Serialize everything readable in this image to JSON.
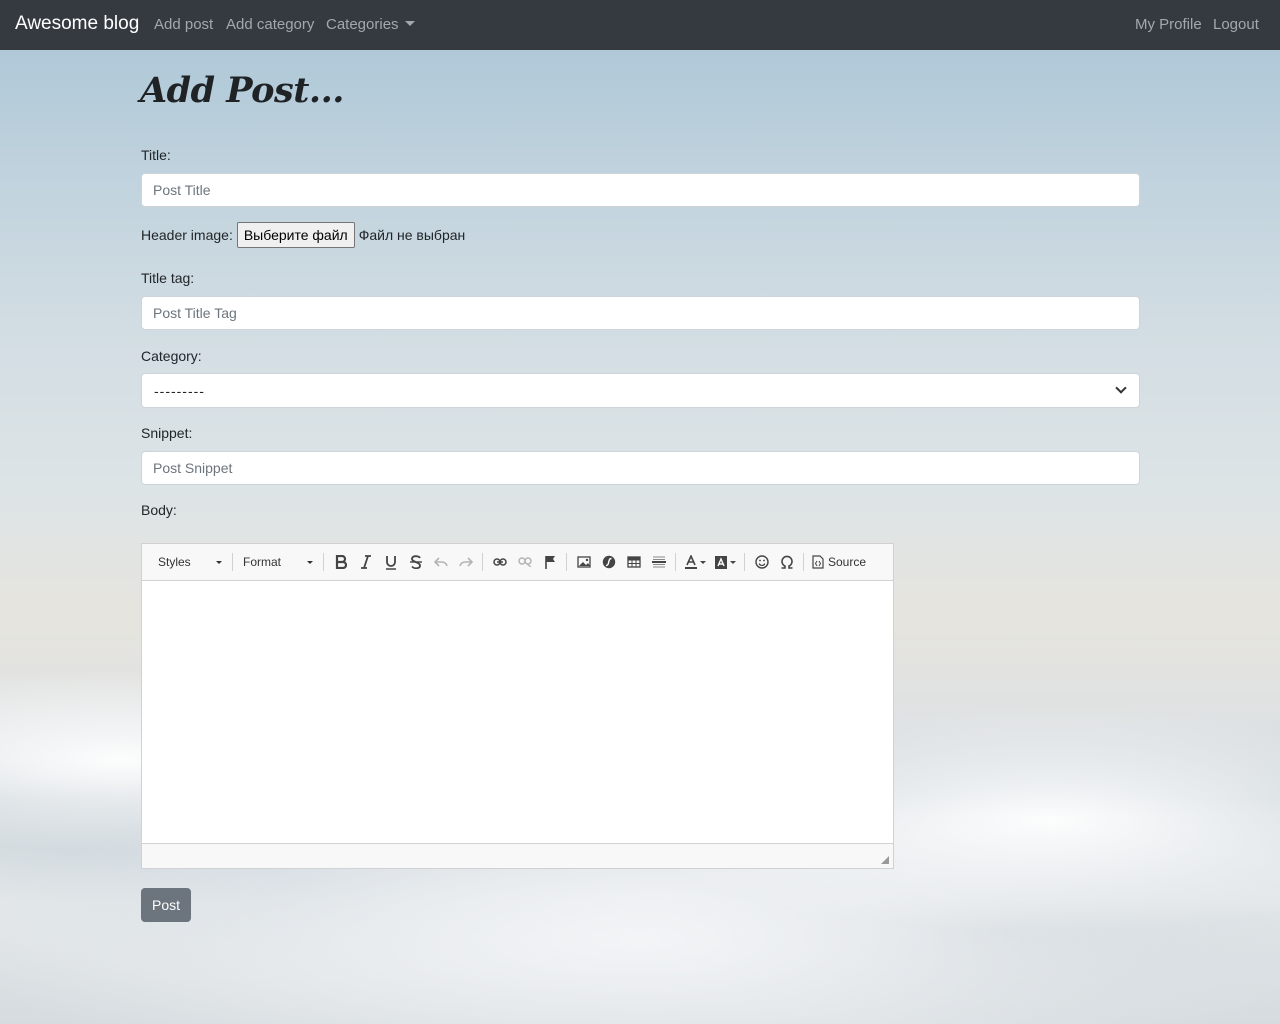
{
  "navbar": {
    "brand": "Awesome blog",
    "links": [
      "Add post",
      "Add category",
      "Categories"
    ],
    "right_links": [
      "My Profile",
      "Logout"
    ]
  },
  "page": {
    "title": "Add Post..."
  },
  "form": {
    "title_label": "Title:",
    "title_placeholder": "Post Title",
    "header_image_label": "Header image:",
    "file_button": "Выберите файл",
    "file_status": "Файл не выбран",
    "title_tag_label": "Title tag:",
    "title_tag_placeholder": "Post Title Tag",
    "category_label": "Category:",
    "category_selected": "---------",
    "snippet_label": "Snippet:",
    "snippet_placeholder": "Post Snippet",
    "body_label": "Body:",
    "submit_label": "Post"
  },
  "editor": {
    "styles_combo": "Styles",
    "format_combo": "Format",
    "source_label": "Source",
    "buttons": [
      "bold-icon",
      "italic-icon",
      "underline-icon",
      "strikethrough-icon",
      "undo-icon",
      "redo-icon",
      "link-icon",
      "unlink-icon",
      "anchor-flag-icon",
      "image-icon",
      "flash-icon",
      "table-icon",
      "horizontal-rule-icon",
      "text-color-icon",
      "background-color-icon",
      "smiley-icon",
      "special-char-icon",
      "source-icon"
    ]
  }
}
